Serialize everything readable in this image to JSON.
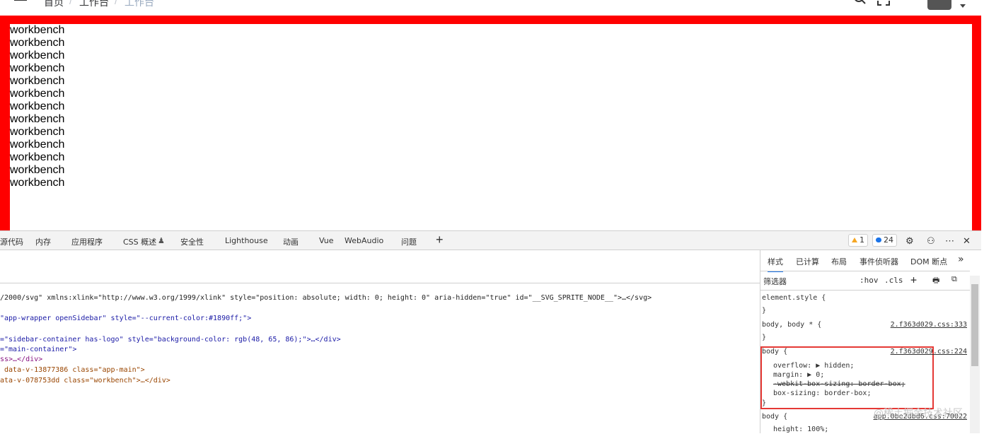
{
  "header": {
    "breadcrumb": [
      "首页",
      "工作台",
      "工作台"
    ],
    "separator": "/"
  },
  "workbench": {
    "lines": [
      "workbench",
      "workbench",
      "workbench",
      "workbench",
      "workbench",
      "workbench",
      "workbench",
      "workbench",
      "workbench",
      "workbench",
      "workbench",
      "workbench",
      "workbench"
    ]
  },
  "devtools": {
    "tabs": [
      "源代码",
      "内存",
      "应用程序",
      "CSS 概述",
      "安全性",
      "Lighthouse",
      "动画",
      "Vue",
      "WebAudio",
      "问题"
    ],
    "add_tab": "+",
    "warnings_count": "1",
    "messages_count": "24",
    "code_lines": [
      {
        "pre": "/2000/svg\" xmlns:xlink=\"http://www.w3.org/1999/xlink\" style=\"position: absolute; width: 0; height: 0\" aria-hidden=\"true\" id=\"__SVG_SPRITE_NODE__\">…</svg>"
      },
      {
        "pre": "\"app-wrapper openSidebar\" style=\"--current-color:#1890ff;\">"
      },
      {
        "pre": "=\"sidebar-container has-logo\" style=\"background-color: rgb(48, 65, 86);\">…</div>"
      },
      {
        "pre": "=\"main-container\">"
      },
      {
        "pre": "ss>…</div>"
      },
      {
        "pre": " data-v-13877386 class=\"app-main\">"
      },
      {
        "pre": "ata-v-078753dd class=\"workbench\">…</div>"
      }
    ]
  },
  "styles_panel": {
    "tabs": [
      "样式",
      "已计算",
      "布局",
      "事件侦听器",
      "DOM 断点"
    ],
    "more": "»",
    "filter_placeholder": "筛选器",
    "hov": ":hov",
    "cls": ".cls",
    "rules": {
      "element_style": "element.style {",
      "close": "}",
      "body_star": "body, body * {",
      "body_star_link": "2.f363d029.css:333",
      "body1": "body {",
      "body1_link": "2.f363d029.css:224",
      "decl_overflow": "overflow: ▶ hidden;",
      "decl_margin": "margin: ▶ 0;",
      "decl_webkit": "-webkit-box-sizing: border-box;",
      "decl_boxsizing": "box-sizing: border-box;",
      "body2": "body {",
      "body2_link": "app.0be2dbd6.css:70022",
      "decl_height": "height: 100%;"
    }
  },
  "watermark": "@稀土掘金技术社区"
}
